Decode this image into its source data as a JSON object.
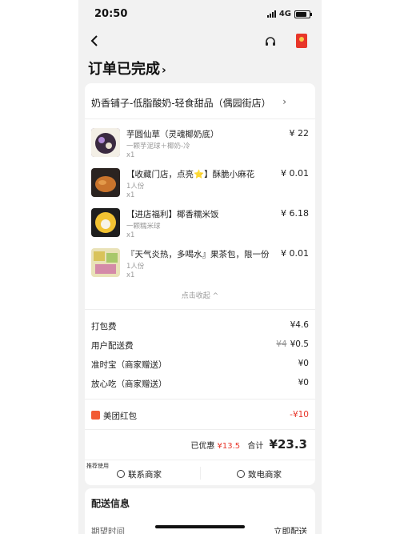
{
  "status_bar": {
    "time": "20:50",
    "network": "4G"
  },
  "header": {
    "back_icon": "chevron-left-icon",
    "service_icon": "headset-icon",
    "redpacket_icon": "red-packet-icon"
  },
  "order": {
    "status": "订单已完成",
    "status_chevron": "›"
  },
  "shop": {
    "name": "奶香铺子-低脂酸奶-轻食甜品（偶园街店）",
    "chevron": "›"
  },
  "items": [
    {
      "name": "芋圆仙草（灵魂椰奶底）",
      "desc": "一颗芋泥球＋椰奶-冷",
      "qty": "x1",
      "price": "¥ 22"
    },
    {
      "name": "【收藏门店，点亮⭐】酥脆小麻花",
      "desc": "1人份",
      "qty": "x1",
      "price": "¥ 0.01"
    },
    {
      "name": "【进店福利】椰香糯米饭",
      "desc": "一颗糯米球",
      "qty": "x1",
      "price": "¥ 6.18"
    },
    {
      "name": "『天气炎热，多喝水』果茶包，限一份",
      "desc": "1人份",
      "qty": "x1",
      "price": "¥ 0.01"
    }
  ],
  "collapse_label": "点击收起 ^",
  "fees": [
    {
      "label": "打包费",
      "value": "¥4.6",
      "original": ""
    },
    {
      "label": "用户配送费",
      "value": "¥0.5",
      "original": "¥4"
    },
    {
      "label": "准时宝（商家赠送）",
      "value": "¥0",
      "original": ""
    },
    {
      "label": "放心吃（商家赠送）",
      "value": "¥0",
      "original": ""
    }
  ],
  "coupon": {
    "label": "美团红包",
    "value": "-¥10"
  },
  "summary": {
    "discount_label": "已优惠",
    "discount_value": "¥13.5",
    "total_label": "合计",
    "total_value": "¥23.3"
  },
  "recommend_label": "推荐使用",
  "actions": {
    "contact_merchant": "联系商家",
    "call_merchant": "致电商家"
  },
  "delivery": {
    "title": "配送信息",
    "expected_label": "期望时间",
    "expected_value": "立即配送"
  },
  "colors": {
    "accent_red": "#e8362a",
    "background": "#f2f2f2"
  }
}
